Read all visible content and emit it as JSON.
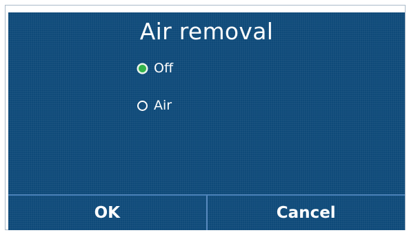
{
  "dialog": {
    "title": "Air removal",
    "options": [
      {
        "label": "Off",
        "selected": true
      },
      {
        "label": "Air",
        "selected": false
      }
    ],
    "ok_label": "OK",
    "cancel_label": "Cancel"
  },
  "colors": {
    "screen_background": "#0e4a79",
    "selected_radio": "#33b34a",
    "text": "#ffffff",
    "divider": "#5a8cc0"
  },
  "icons": {
    "selected": "radio-checked-icon",
    "unselected": "radio-unchecked-icon"
  }
}
